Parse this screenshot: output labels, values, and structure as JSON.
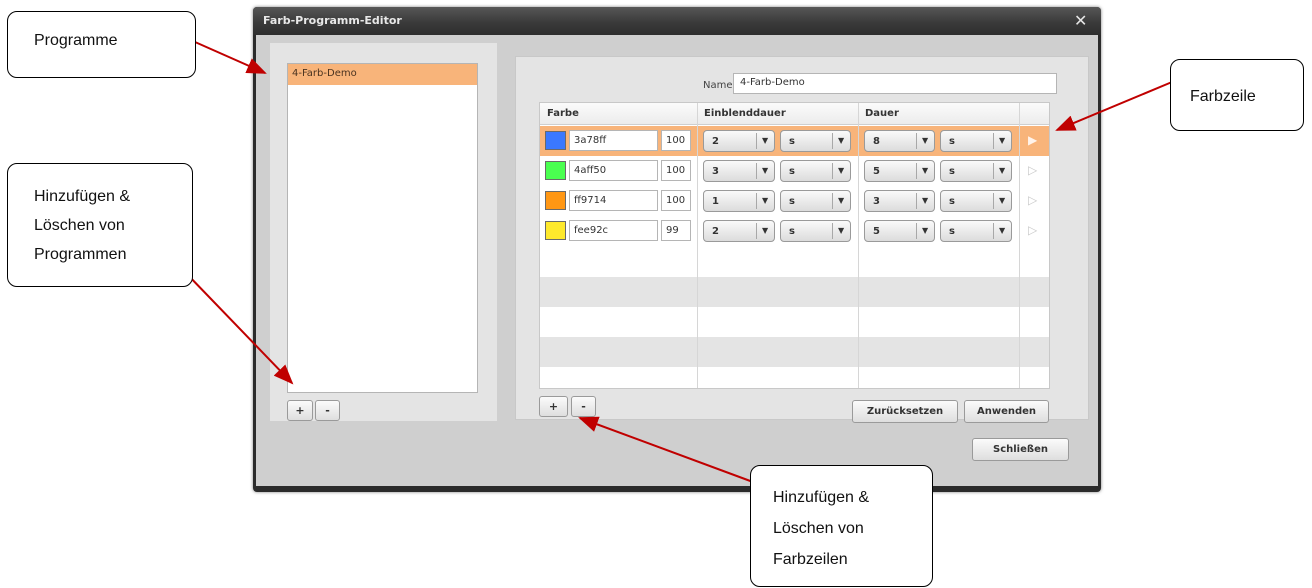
{
  "dialog": {
    "title": "Farb-Programm-Editor",
    "close_glyph": "✕",
    "close_button_label": "Schließen"
  },
  "programs": {
    "items": [
      "4-Farb-Demo"
    ],
    "selected_index": 0,
    "add_label": "+",
    "remove_label": "-"
  },
  "editor": {
    "name_label": "Name",
    "name_value": "4-Farb-Demo",
    "columns": [
      "Farbe",
      "Einblenddauer",
      "Dauer"
    ],
    "rows": [
      {
        "color": "#3a78ff",
        "hex": "3a78ff",
        "intensity": "100",
        "fade_value": "2",
        "fade_unit": "s",
        "dur_value": "8",
        "dur_unit": "s",
        "selected": true
      },
      {
        "color": "#4aff50",
        "hex": "4aff50",
        "intensity": "100",
        "fade_value": "3",
        "fade_unit": "s",
        "dur_value": "5",
        "dur_unit": "s",
        "selected": false
      },
      {
        "color": "#ff9714",
        "hex": "ff9714",
        "intensity": "100",
        "fade_value": "1",
        "fade_unit": "s",
        "dur_value": "3",
        "dur_unit": "s",
        "selected": false
      },
      {
        "color": "#fee92c",
        "hex": "fee92c",
        "intensity": "99",
        "fade_value": "2",
        "fade_unit": "s",
        "dur_value": "5",
        "dur_unit": "s",
        "selected": false
      }
    ],
    "add_label": "+",
    "remove_label": "-",
    "reset_label": "Zurücksetzen",
    "apply_label": "Anwenden"
  },
  "annotations": {
    "programme": "Programme",
    "farbzeile": "Farbzeile",
    "programs_add_remove": [
      "Hinzufügen &",
      "Löschen von",
      "Programmen"
    ],
    "rows_add_remove": [
      "Hinzufügen &",
      "Löschen von",
      "Farbzeilen"
    ]
  },
  "colors": {
    "selection": "#f8b47a",
    "arrow": "#c00000",
    "titlebar": "#3a3a3a"
  },
  "icons": {
    "dropdown": "chevron-down-icon",
    "row_play": "play-icon",
    "close": "close-icon"
  }
}
